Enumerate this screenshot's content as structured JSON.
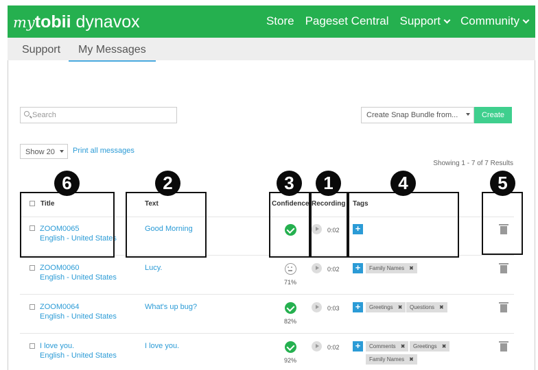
{
  "header": {
    "logo": {
      "my": "my",
      "tobii": "tobii",
      "dynavox": "dynavox"
    },
    "nav": [
      {
        "label": "Store"
      },
      {
        "label": "Pageset Central"
      },
      {
        "label": "Support"
      },
      {
        "label": "Community"
      }
    ]
  },
  "subnav": {
    "tabs": [
      {
        "label": "Support"
      },
      {
        "label": "My Messages"
      }
    ],
    "active": "My Messages"
  },
  "toolbar": {
    "search_placeholder": "Search",
    "bundle_select": "Create Snap Bundle from...",
    "create_label": "Create",
    "show_select": "Show 20",
    "print_all": "Print all messages",
    "showing": "Showing 1 - 7 of 7 Results"
  },
  "table": {
    "headers": {
      "title": "Title",
      "text": "Text",
      "confidence": "Confidence",
      "recording": "Recording",
      "tags": "Tags"
    },
    "rows": [
      {
        "title": "ZOOM0065",
        "language": "English - United States",
        "text": "Good Morning",
        "confidence": "",
        "duration": "0:02",
        "tags": []
      },
      {
        "title": "ZOOM0060",
        "language": "English - United States",
        "text": "Lucy.",
        "confidence": "71%",
        "duration": "0:02",
        "tags": [
          "Family Names"
        ]
      },
      {
        "title": "ZOOM0064",
        "language": "English - United States",
        "text": "What's up bug?",
        "confidence": "82%",
        "duration": "0:03",
        "tags": [
          "Greetings",
          "Questions"
        ]
      },
      {
        "title": "I love you.",
        "language": "English - United States",
        "text": "I love you.",
        "confidence": "92%",
        "duration": "0:02",
        "tags": [
          "Comments",
          "Greetings",
          "Family Names"
        ]
      }
    ]
  },
  "callouts": [
    "6",
    "2",
    "3",
    "1",
    "4",
    "5"
  ],
  "colors": {
    "brand_green": "#25b04f",
    "link_blue": "#2b9bd6",
    "create_green": "#3fcf8e"
  }
}
